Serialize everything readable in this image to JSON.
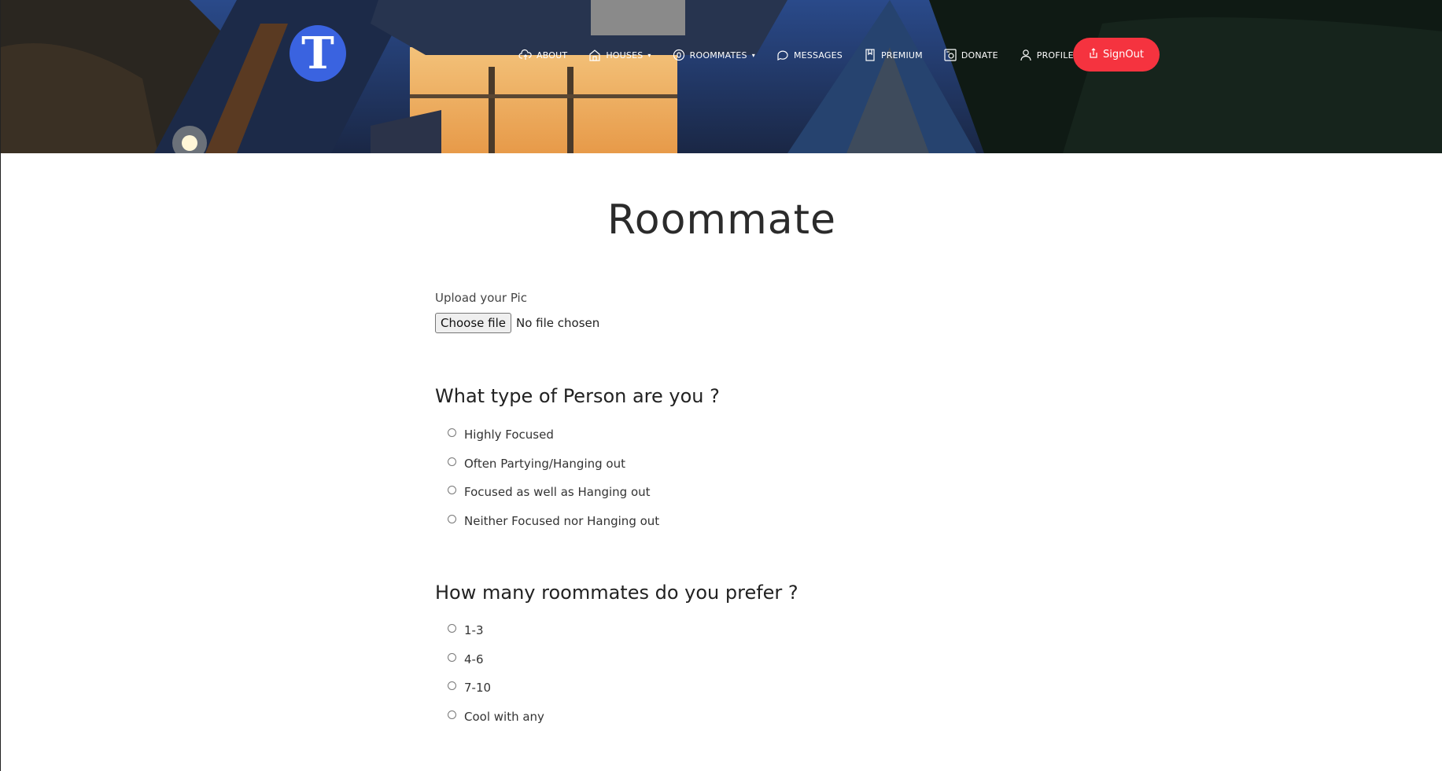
{
  "header": {
    "logo_letter": "T",
    "nav": [
      {
        "label": "ABOUT",
        "icon": "cloud-upload-icon",
        "dropdown": false
      },
      {
        "label": "HOUSES",
        "icon": "house-icon",
        "dropdown": true
      },
      {
        "label": "ROOMMATES",
        "icon": "roommates-icon",
        "dropdown": true
      },
      {
        "label": "MESSAGES",
        "icon": "chat-bubble-icon",
        "dropdown": false
      },
      {
        "label": "PREMIUM",
        "icon": "bookmark-icon",
        "dropdown": false
      },
      {
        "label": "DONATE",
        "icon": "donate-icon",
        "dropdown": false
      },
      {
        "label": "PROFILE",
        "icon": "user-icon",
        "dropdown": false
      }
    ],
    "signout_label": "SignOut",
    "accent_color": "#f5333f",
    "logo_color": "#3a63e0"
  },
  "page": {
    "title": "Roommate",
    "upload": {
      "label": "Upload your Pic",
      "button_label": "Choose file",
      "status": "No file chosen"
    },
    "questions": [
      {
        "title": "What type of Person are you ?",
        "options": [
          "Highly Focused",
          "Often Partying/Hanging out",
          "Focused as well as Hanging out",
          "Neither Focused nor Hanging out"
        ]
      },
      {
        "title": "How many roommates do you prefer ?",
        "options": [
          "1-3",
          "4-6",
          "7-10",
          "Cool with any"
        ]
      }
    ]
  }
}
